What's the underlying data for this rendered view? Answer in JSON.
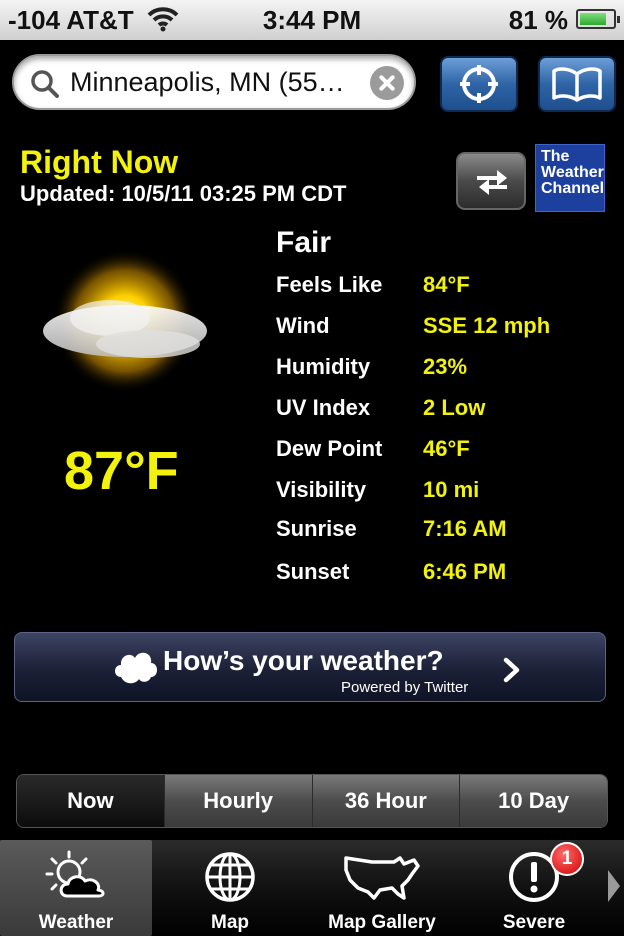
{
  "status_bar": {
    "carrier": "-104 AT&T",
    "time": "3:44 PM",
    "battery": "81 %",
    "battery_level": 0.81
  },
  "search": {
    "value": "Minneapolis, MN (55…"
  },
  "right_now": {
    "title": "Right Now",
    "updated": "Updated: 10/5/11 03:25 PM CDT"
  },
  "logo": {
    "lines": [
      "The",
      "Weather",
      "Channel"
    ]
  },
  "current": {
    "temperature": "87°F",
    "condition": "Fair",
    "details": [
      {
        "label": "Feels Like",
        "value": "84°F"
      },
      {
        "label": "Wind",
        "value": "SSE 12 mph"
      },
      {
        "label": "Humidity",
        "value": "23%"
      },
      {
        "label": "UV Index",
        "value": "2 Low"
      },
      {
        "label": "Dew Point",
        "value": "46°F"
      },
      {
        "label": "Visibility",
        "value": "10 mi"
      },
      {
        "label": "Sunrise",
        "value": "7:16 AM"
      },
      {
        "label": "Sunset",
        "value": "6:46 PM"
      }
    ]
  },
  "banner": {
    "headline": "How’s your weather?",
    "sub": "Powered by Twitter"
  },
  "segments": [
    {
      "label": "Now",
      "active": true
    },
    {
      "label": "Hourly",
      "active": false
    },
    {
      "label": "36 Hour",
      "active": false
    },
    {
      "label": "10 Day",
      "active": false
    }
  ],
  "tabs": [
    {
      "label": "Weather",
      "icon": "weather-icon",
      "active": true
    },
    {
      "label": "Map",
      "icon": "globe-icon",
      "active": false
    },
    {
      "label": "Map Gallery",
      "icon": "usa-map-icon",
      "active": false
    },
    {
      "label": "Severe",
      "icon": "alert-icon",
      "active": false
    }
  ],
  "severe_badge": "1",
  "colors": {
    "accent_yellow": "#f2f20a",
    "button_blue": "#2f64a6",
    "twc_blue": "#1d3f9e",
    "badge_red": "#d10000"
  }
}
